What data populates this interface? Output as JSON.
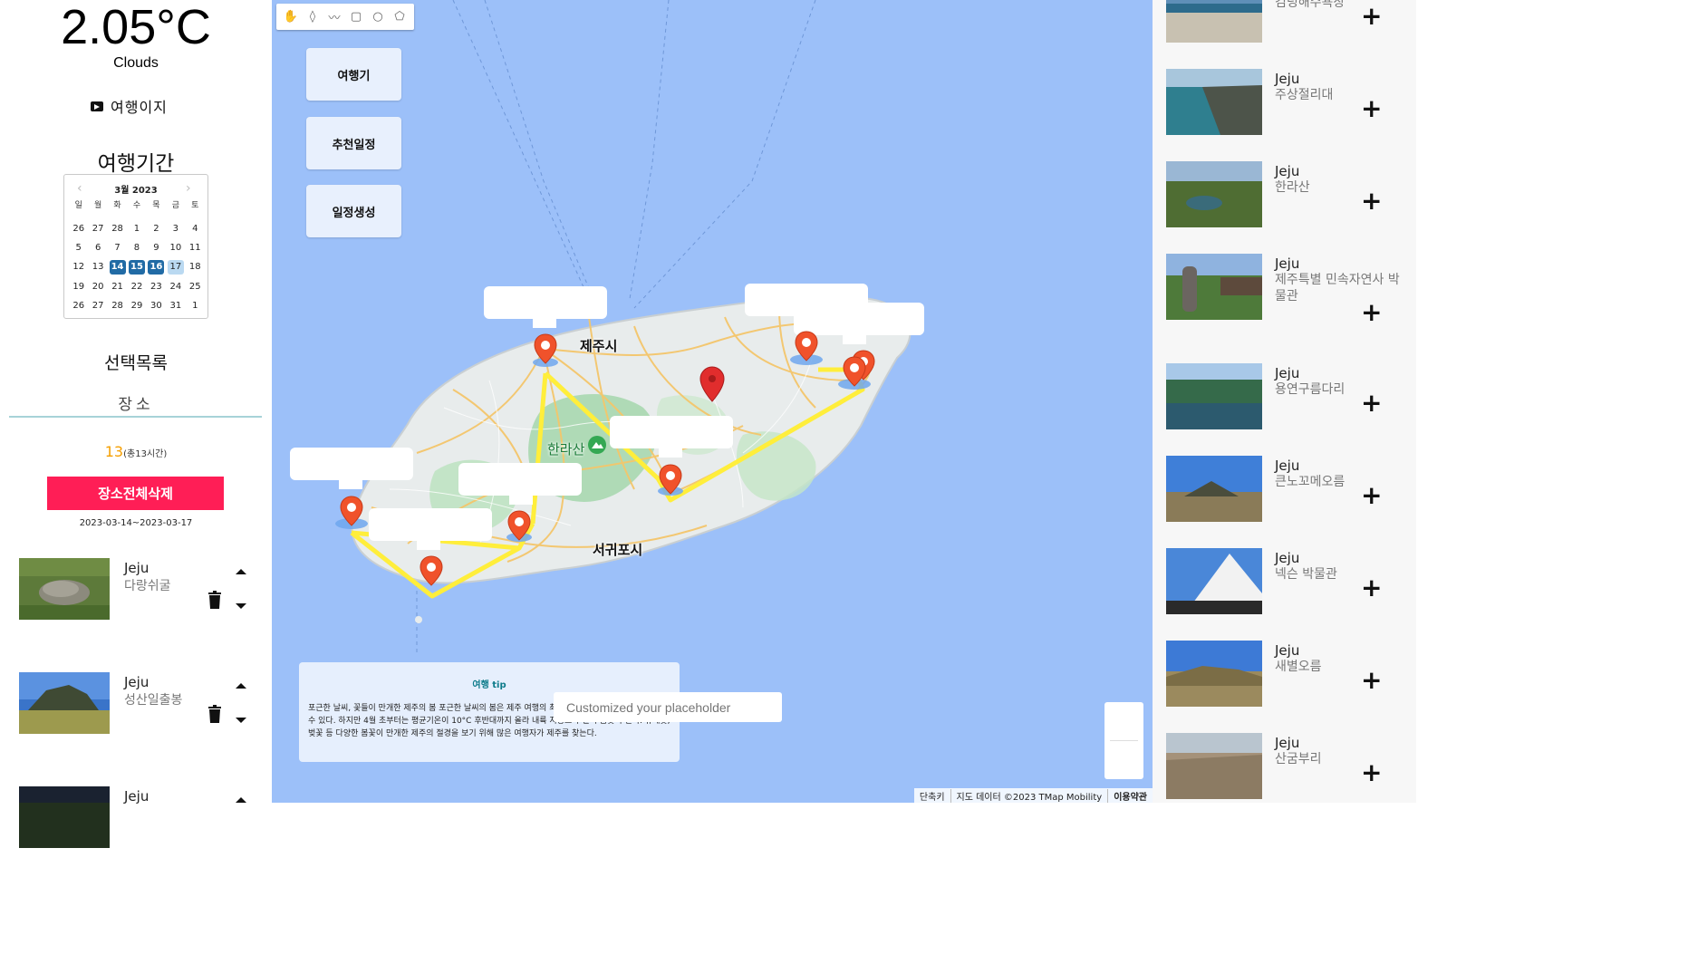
{
  "weather": {
    "temperature": "2.05°C",
    "condition": "Clouds"
  },
  "logo": {
    "text": "여행이지"
  },
  "period": {
    "heading": "여행기간",
    "calendar": {
      "month_label": "3월 2023",
      "weekdays": [
        "일",
        "월",
        "화",
        "수",
        "목",
        "금",
        "토"
      ],
      "days": [
        "26",
        "27",
        "28",
        "1",
        "2",
        "3",
        "4",
        "5",
        "6",
        "7",
        "8",
        "9",
        "10",
        "11",
        "12",
        "13",
        "14",
        "15",
        "16",
        "17",
        "18",
        "19",
        "20",
        "21",
        "22",
        "23",
        "24",
        "25",
        "26",
        "27",
        "28",
        "29",
        "30",
        "31",
        "1"
      ],
      "selected": [
        "14",
        "15",
        "16"
      ],
      "keyboard_selected": "17"
    }
  },
  "selection": {
    "heading": "선택목록",
    "tab_label": "장소",
    "count": "13",
    "count_detail": "(총13시간)",
    "delete_all_label": "장소전체삭제",
    "date_range": "2023-03-14~2023-03-17",
    "items": [
      {
        "city": "Jeju",
        "name": "다랑쉬굴"
      },
      {
        "city": "Jeju",
        "name": "성산일출봉"
      },
      {
        "city": "Jeju",
        "name": ""
      }
    ]
  },
  "map": {
    "tools": [
      "hand-icon",
      "marker-icon",
      "polyline-icon",
      "rectangle-icon",
      "circle-icon",
      "polygon-icon"
    ],
    "buttons": {
      "trip": "여행기",
      "recommend": "추천일정",
      "create": "일정생성"
    },
    "labels": {
      "jeju_city": "제주시",
      "hallasan": "한라산",
      "seogwipo": "서귀포시"
    },
    "tip_title": "여행 tip",
    "tip_body": "포근한 날씨, 꽃들이 만개한 제주의 봄 포근한 날씨의 봄은 제주 여행의 최적기. 3월까지는 꽃샘추위로 추울 수 있다. 하지만 4월 초부터는 평균기온이 10°C 후반대까지 올라 내륙 지방보다 일찍 봄꽃이 핀다. 유채꽃, 벚꽃 등 다양한 봄꽃이 만개한 제주의 절경을 보기 위해 많은 여행자가 제주를 찾는다.",
    "input_placeholder": "Customized your placeholder",
    "attribution": {
      "shortcut": "단축키",
      "data": "지도 데이터 ©2023 TMap Mobility",
      "terms": "이용약관"
    },
    "route_color": "#ffee3b",
    "pin_color": "#f0522b"
  },
  "recommendations": [
    {
      "city": "",
      "name": "김녕해수욕장"
    },
    {
      "city": "Jeju",
      "name": "주상절리대"
    },
    {
      "city": "Jeju",
      "name": "한라산"
    },
    {
      "city": "Jeju",
      "name": "제주특별 민속자연사 박물관"
    },
    {
      "city": "Jeju",
      "name": "용연구름다리"
    },
    {
      "city": "Jeju",
      "name": "큰노꼬메오름"
    },
    {
      "city": "Jeju",
      "name": "넥슨 박물관"
    },
    {
      "city": "Jeju",
      "name": "새별오름"
    },
    {
      "city": "Jeju",
      "name": "산굼부리"
    }
  ],
  "colors": {
    "accent_red": "#ff1e56",
    "count_orange": "#f59f00",
    "calendar_blue": "#216ba5",
    "map_water": "#9cc0f9"
  }
}
